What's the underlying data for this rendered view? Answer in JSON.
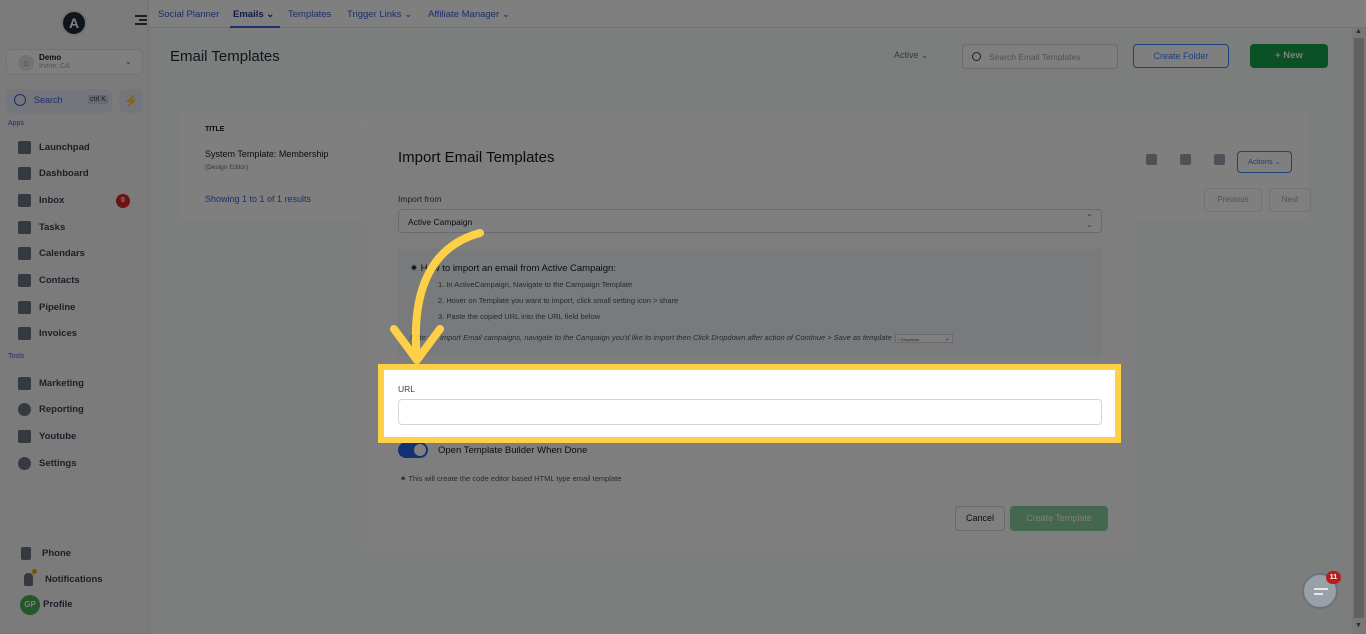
{
  "sidebar": {
    "logo_letter": "A",
    "location": {
      "name": "Demo",
      "sub": "Irvine, CA"
    },
    "search": {
      "label": "Search",
      "shortcut": "ctrl K"
    },
    "sections": {
      "apps": "Apps",
      "tools": "Tools"
    },
    "apps": [
      {
        "label": "Launchpad",
        "icon": "rocket-icon"
      },
      {
        "label": "Dashboard",
        "icon": "grid-icon"
      },
      {
        "label": "Inbox",
        "icon": "inbox-icon",
        "badge": "0"
      },
      {
        "label": "Tasks",
        "icon": "clipboard-icon"
      },
      {
        "label": "Calendars",
        "icon": "calendar-icon"
      },
      {
        "label": "Contacts",
        "icon": "person-icon"
      },
      {
        "label": "Pipeline",
        "icon": "funnel-icon"
      },
      {
        "label": "Invoices",
        "icon": "invoice-icon"
      }
    ],
    "tools": [
      {
        "label": "Marketing",
        "icon": "megaphone-icon"
      },
      {
        "label": "Reporting",
        "icon": "pie-chart-icon"
      },
      {
        "label": "Youtube",
        "icon": "youtube-icon"
      },
      {
        "label": "Settings",
        "icon": "gear-icon"
      }
    ],
    "bottom": [
      {
        "label": "Phone",
        "icon": "phone-icon"
      },
      {
        "label": "Notifications",
        "icon": "bell-icon"
      },
      {
        "label": "Profile",
        "initials": "GP"
      }
    ]
  },
  "topnav": {
    "tabs": [
      {
        "label": "Social Planner"
      },
      {
        "label": "Emails ⌄",
        "active": true
      },
      {
        "label": "Templates"
      },
      {
        "label": "Trigger Links ⌄"
      },
      {
        "label": "Affiliate Manager ⌄"
      }
    ]
  },
  "page": {
    "title": "Email Templates",
    "filter": "Active ⌄",
    "search_placeholder": "Search Email Templates",
    "create_folder": "Create Folder",
    "new_button": "+   New",
    "table": {
      "header": "TITLE",
      "rows": [
        {
          "title": "System Template: Membership",
          "sub": "(Design Editor)"
        }
      ],
      "actions": "Actions ⌄",
      "showing": "Showing 1 to 1 of 1 results",
      "previous": "Previous",
      "next": "Next"
    }
  },
  "modal": {
    "title": "Import Email Templates",
    "import_from_label": "Import from",
    "import_from_value": "Active Campaign",
    "info": {
      "heading": "How to import an email from Active Campaign:",
      "steps": [
        "1. In ActiveCampaign, Navigate to the Campaign Template",
        "2. Hover on Template you want to import, click small setting icon > share",
        "3. Paste the copied URL into the URL field below"
      ],
      "note": "Note: To import Email campaigns, navigate to the Campaign you'd like to import then Click Dropdown after action of Continue > Save as template",
      "mini_select": "+ Dropdown"
    },
    "url_label": "URL",
    "url_value": "",
    "toggle_label": "Open Template Builder When Done",
    "toggle_on": true,
    "hint": "This will create the code editor based HTML type email template",
    "cancel": "Cancel",
    "create": "Create Template"
  },
  "chat": {
    "badge": "11"
  },
  "colors": {
    "highlight": "#fdd048",
    "primary": "#2563eb",
    "success": "#16a34a"
  }
}
